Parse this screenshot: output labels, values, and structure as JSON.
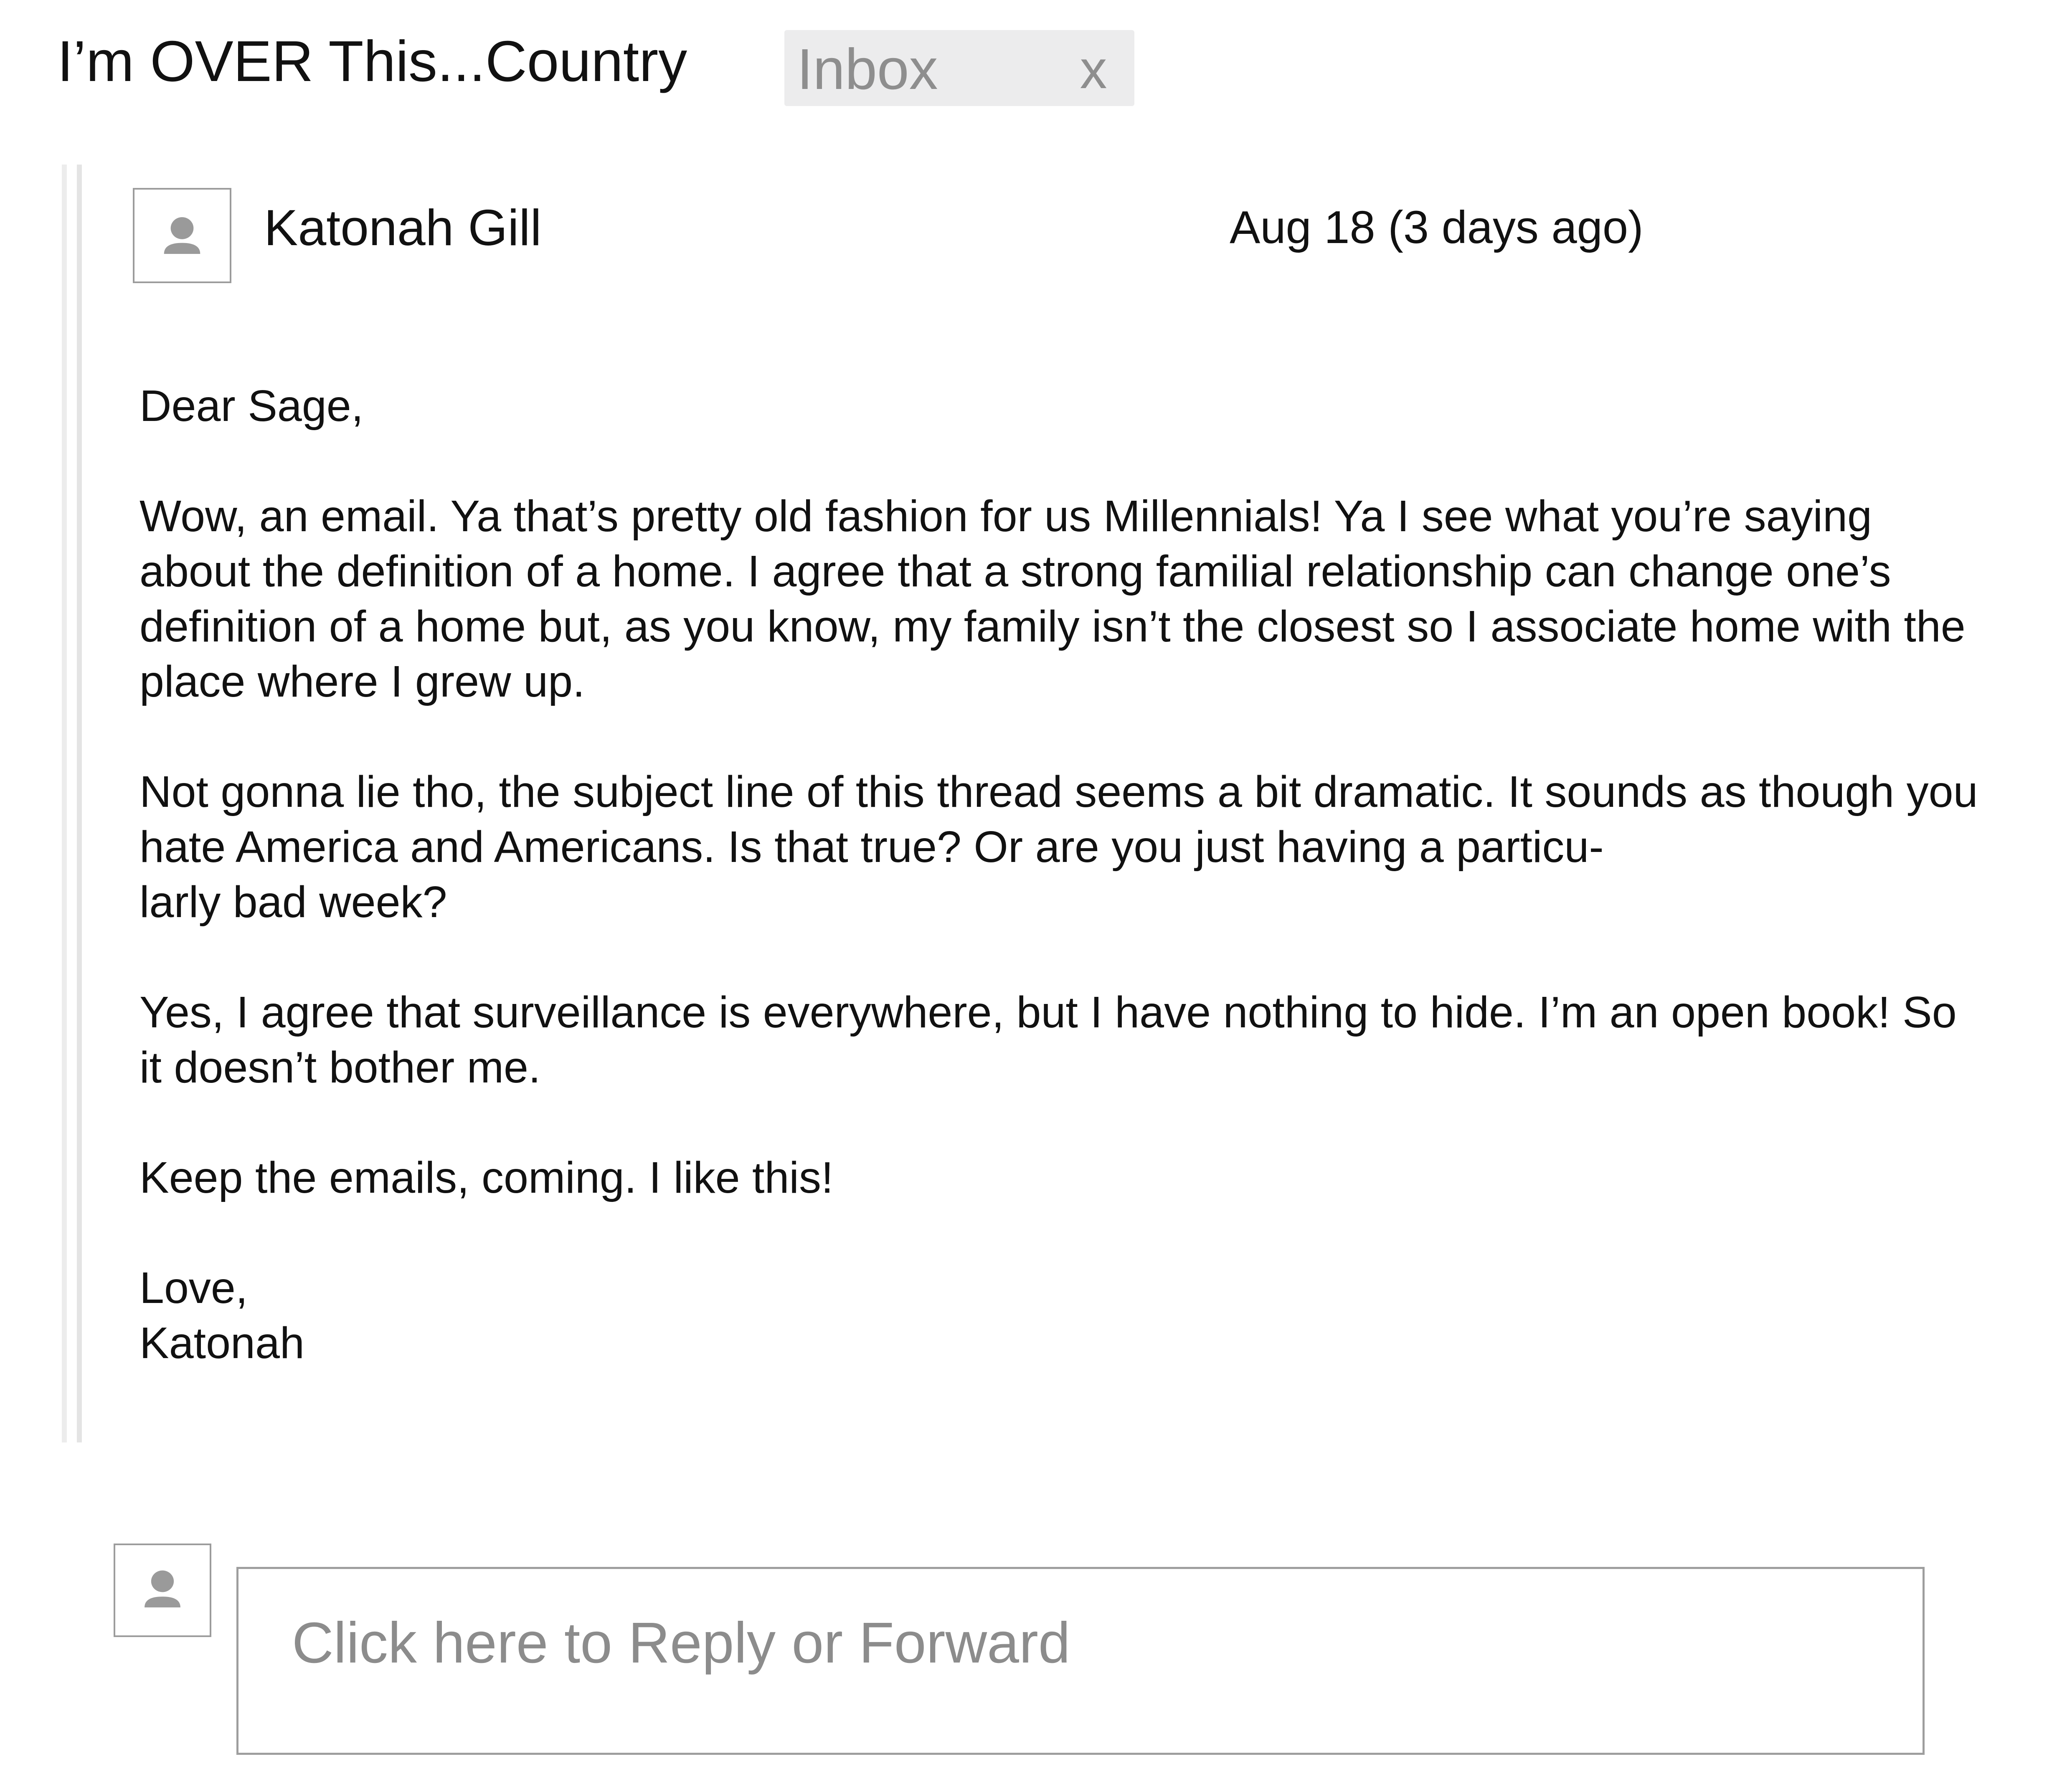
{
  "thread": {
    "subject": "I’m OVER This...Country",
    "label": "Inbox",
    "label_close": "x"
  },
  "message": {
    "sender_name": "Katonah Gill",
    "timestamp": "Aug 18 (3 days ago)",
    "avatar_icon": "person-icon",
    "paragraphs": [
      "Dear Sage,",
      "Wow, an email. Ya that’s pretty old fashion for us Millennials! Ya I see what you’re saying about the definition of a home. I agree that a strong familial relationship can change one’s definition of a home but, as you know, my family isn’t the closest so I associate home with the place where I grew up.",
      "Not gonna lie tho, the subject line of this thread seems a bit dramatic. It sounds as though you hate America and Americans. Is that true? Or are you just having a particu-\nlarly bad week?",
      "Yes, I agree that surveillance is everywhere, but I have nothing to hide. I’m an open book! So it doesn’t bother me.",
      "Keep the emails, coming. I like this!",
      "Love,\nKatonah"
    ]
  },
  "reply": {
    "placeholder": "Click here to Reply or Forward",
    "avatar_icon": "person-icon"
  },
  "colors": {
    "text": "#111111",
    "muted_text": "#8e8e8e",
    "chip_background": "#ececed",
    "border": "#9c9c9c",
    "avatar_glyph": "#9a9a9a",
    "rail": "#e8e8e8"
  }
}
